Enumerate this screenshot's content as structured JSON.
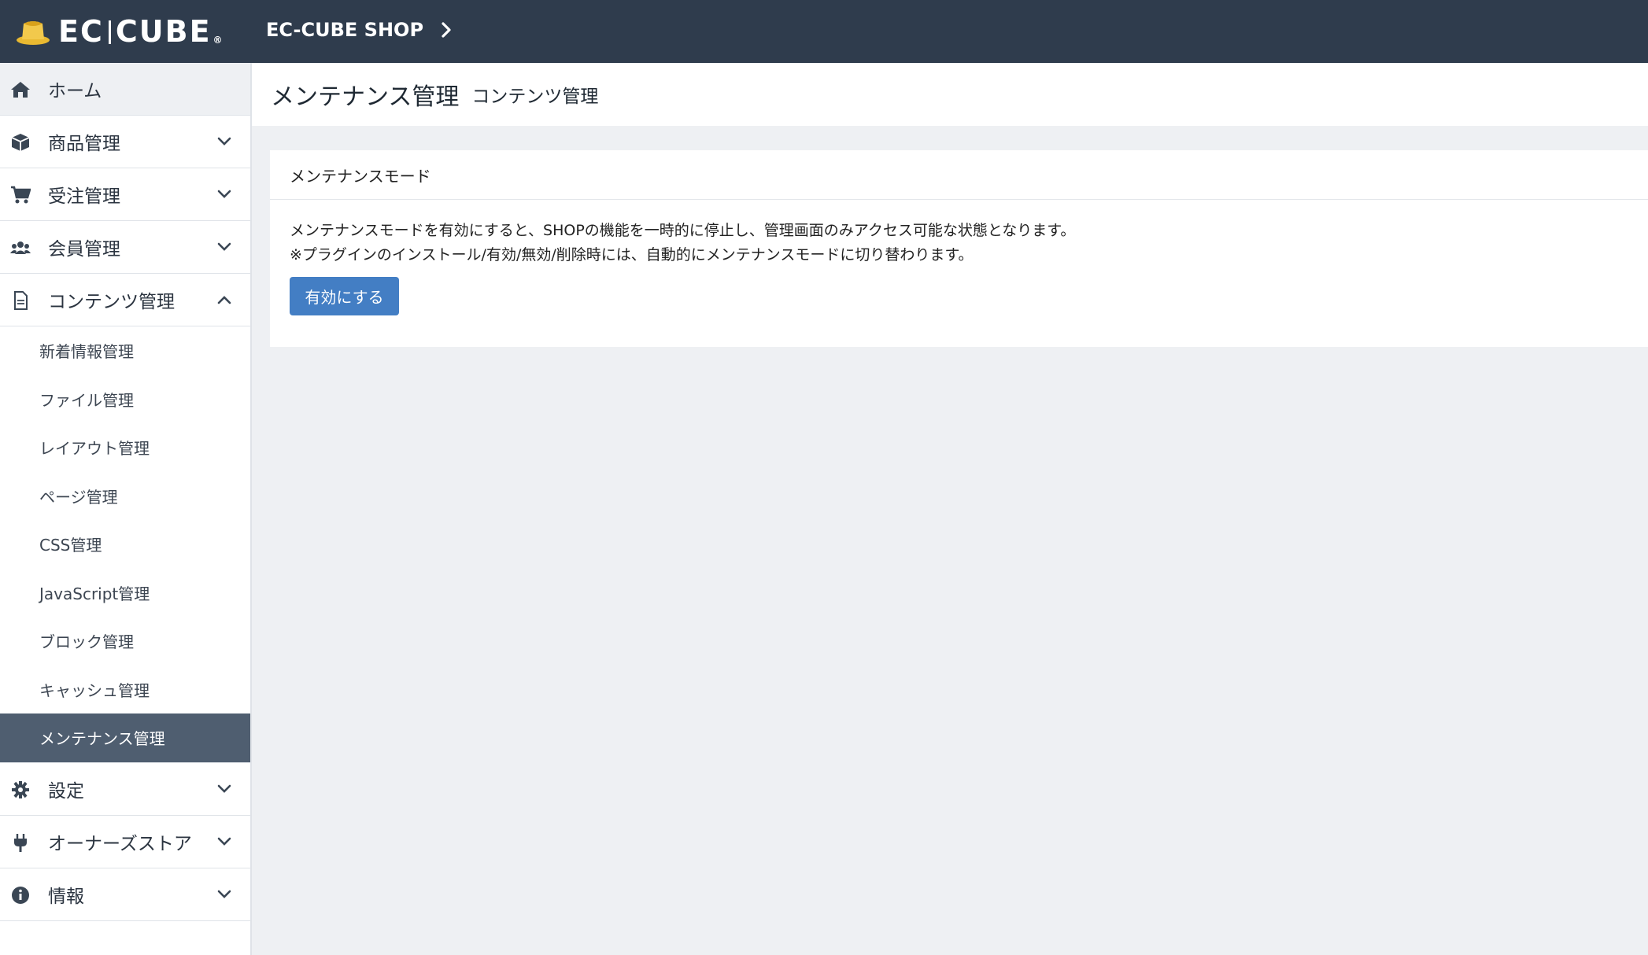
{
  "header": {
    "logo_text": "EC|CUBE",
    "shop_name": "EC-CUBE SHOP"
  },
  "sidebar": {
    "items": [
      {
        "label": "ホーム",
        "icon": "home-icon"
      },
      {
        "label": "商品管理",
        "icon": "box-icon",
        "state": "collapsed"
      },
      {
        "label": "受注管理",
        "icon": "cart-icon",
        "state": "collapsed"
      },
      {
        "label": "会員管理",
        "icon": "users-icon",
        "state": "collapsed"
      },
      {
        "label": "コンテンツ管理",
        "icon": "file-icon",
        "state": "expanded"
      },
      {
        "label": "設定",
        "icon": "gear-icon",
        "state": "collapsed"
      },
      {
        "label": "オーナーズストア",
        "icon": "plug-icon",
        "state": "collapsed"
      },
      {
        "label": "情報",
        "icon": "info-icon",
        "state": "collapsed"
      }
    ],
    "content_sub": [
      "新着情報管理",
      "ファイル管理",
      "レイアウト管理",
      "ページ管理",
      "CSS管理",
      "JavaScript管理",
      "ブロック管理",
      "キャッシュ管理",
      "メンテナンス管理"
    ],
    "active_sub": "メンテナンス管理"
  },
  "page": {
    "title": "メンテナンス管理",
    "subtitle": "コンテンツ管理"
  },
  "card": {
    "header": "メンテナンスモード",
    "line1": "メンテナンスモードを有効にすると、SHOPの機能を一時的に停止し、管理画面のみアクセス可能な状態となります。",
    "line2": "※プラグインのインストール/有効/無効/削除時には、自動的にメンテナンスモードに切り替わります。",
    "button": "有効にする"
  },
  "colors": {
    "header_bg": "#2f3c4d",
    "active_bg": "#4f5e70",
    "button_bg": "#437ec4",
    "logo_gold": "#e9b931"
  }
}
